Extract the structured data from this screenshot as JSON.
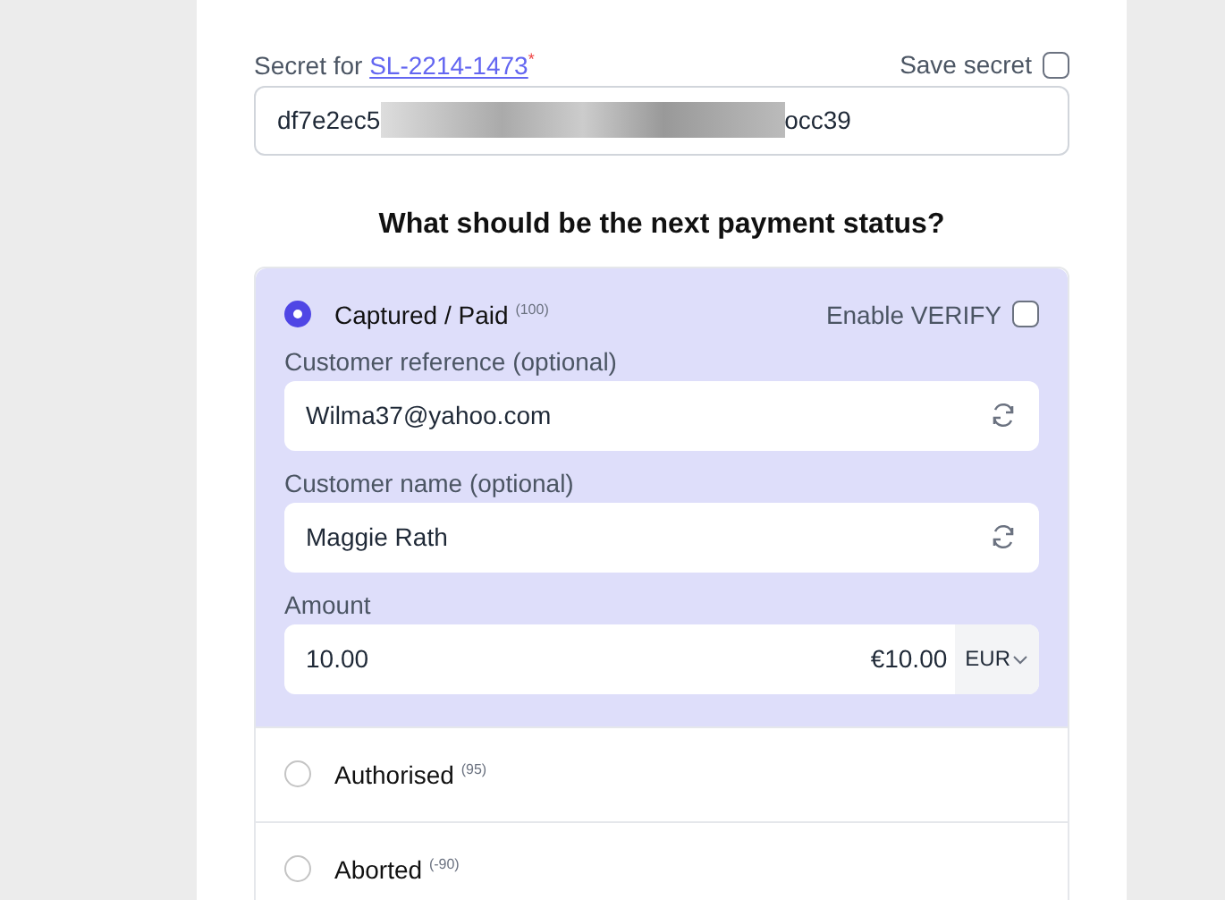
{
  "secret": {
    "label": "Secret for",
    "link": "SL-2214-1473",
    "required_mark": "*",
    "save_label": "Save secret",
    "save_checked": false,
    "value_start": "df7e2ec5",
    "value_end": "occ39"
  },
  "heading": "What should be the next payment status?",
  "statuses": [
    {
      "label": "Captured / Paid",
      "code": "(100)",
      "selected": true,
      "verify_label": "Enable VERIFY",
      "verify_checked": false,
      "fields": [
        {
          "kind": "refresh",
          "label": "Customer reference (optional)",
          "value": "Wilma37@yahoo.com"
        },
        {
          "kind": "refresh",
          "label": "Customer name (optional)",
          "value": "Maggie Rath"
        },
        {
          "kind": "amount",
          "label": "Amount",
          "value": "10.00",
          "formatted": "€10.00",
          "currency": "EUR"
        }
      ]
    },
    {
      "label": "Authorised",
      "code": "(95)",
      "selected": false
    },
    {
      "label": "Aborted",
      "code": "(-90)",
      "selected": false
    }
  ]
}
